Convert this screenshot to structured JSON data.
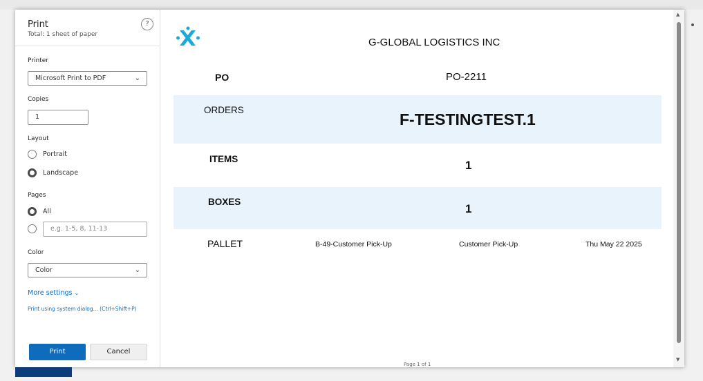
{
  "panel": {
    "title": "Print",
    "subtitle": "Total: 1 sheet of paper",
    "help_glyph": "?",
    "printer_label": "Printer",
    "printer_value": "Microsoft Print to PDF",
    "copies_label": "Copies",
    "copies_value": "1",
    "layout_label": "Layout",
    "layout_options": [
      "Portrait",
      "Landscape"
    ],
    "layout_selected": "Landscape",
    "pages_label": "Pages",
    "pages_all": "All",
    "pages_range_placeholder": "e.g. 1-5, 8, 11-13",
    "color_label": "Color",
    "color_value": "Color",
    "more_settings": "More settings",
    "system_dialog": "Print using system dialog... (Ctrl+Shift+P)",
    "print_button": "Print",
    "cancel_button": "Cancel"
  },
  "preview": {
    "company": "G-GLOBAL LOGISTICS INC",
    "po_label": "PO",
    "po_value": "PO-2211",
    "orders_label": "ORDERS",
    "orders_value": "F-TESTINGTEST.1",
    "items_label": "ITEMS",
    "items_value": "1",
    "boxes_label": "BOXES",
    "boxes_value": "1",
    "pallet_label": "PALLET",
    "pallet_location": "B-49-Customer Pick-Up",
    "pallet_method": "Customer Pick-Up",
    "pallet_date": "Thu May 22 2025",
    "footer": "Page 1 of 1"
  },
  "colors": {
    "accent": "#0f6cbd",
    "band": "#e8f3fc",
    "logo": "#1aa9d8"
  },
  "icons": [
    "help-icon",
    "chevron-down-icon",
    "company-logo-icon"
  ]
}
